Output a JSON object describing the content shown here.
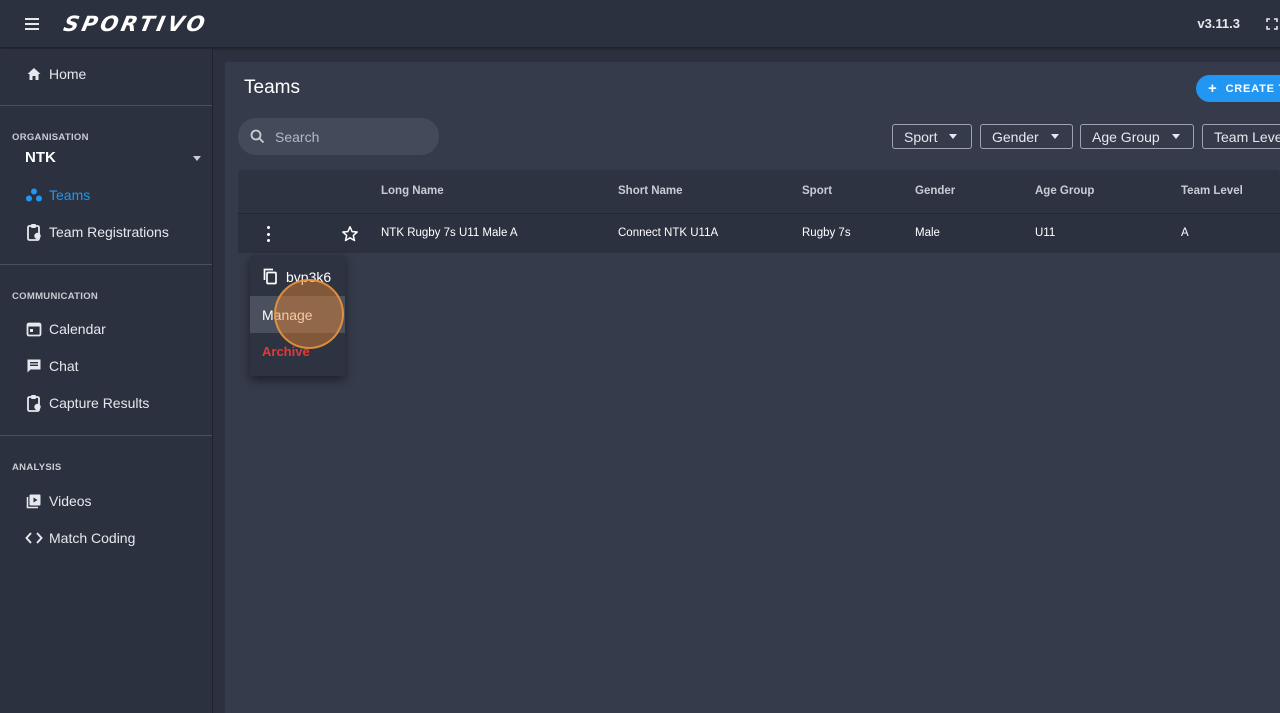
{
  "topbar": {
    "brand": "SPORTIVO",
    "version": "v3.11.3"
  },
  "sidebar": {
    "home": "Home",
    "organisation_label": "ORGANISATION",
    "organisation_value": "NTK",
    "teams": "Teams",
    "team_registrations": "Team Registrations",
    "communication_label": "COMMUNICATION",
    "calendar": "Calendar",
    "chat": "Chat",
    "capture_results": "Capture Results",
    "analysis_label": "ANALYSIS",
    "videos": "Videos",
    "match_coding": "Match Coding"
  },
  "main": {
    "title": "Teams",
    "create_label": "CREATE T",
    "search_placeholder": "Search",
    "filters": [
      "Sport",
      "Gender",
      "Age Group",
      "Team Leve"
    ]
  },
  "table": {
    "headers": [
      "Long Name",
      "Short Name",
      "Sport",
      "Gender",
      "Age Group",
      "Team Level"
    ],
    "rows": [
      {
        "long_name": "NTK Rugby 7s U11 Male A",
        "short_name": "Connect NTK U11A",
        "sport": "Rugby 7s",
        "gender": "Male",
        "age_group": "U11",
        "team_level": "A"
      }
    ]
  },
  "row_menu": {
    "code": "bvp3k6",
    "manage": "Manage",
    "archive": "Archive"
  },
  "colors": {
    "accent": "#2196f3",
    "danger": "#e53935",
    "background": "#2c313f",
    "panel": "#353b4a"
  }
}
